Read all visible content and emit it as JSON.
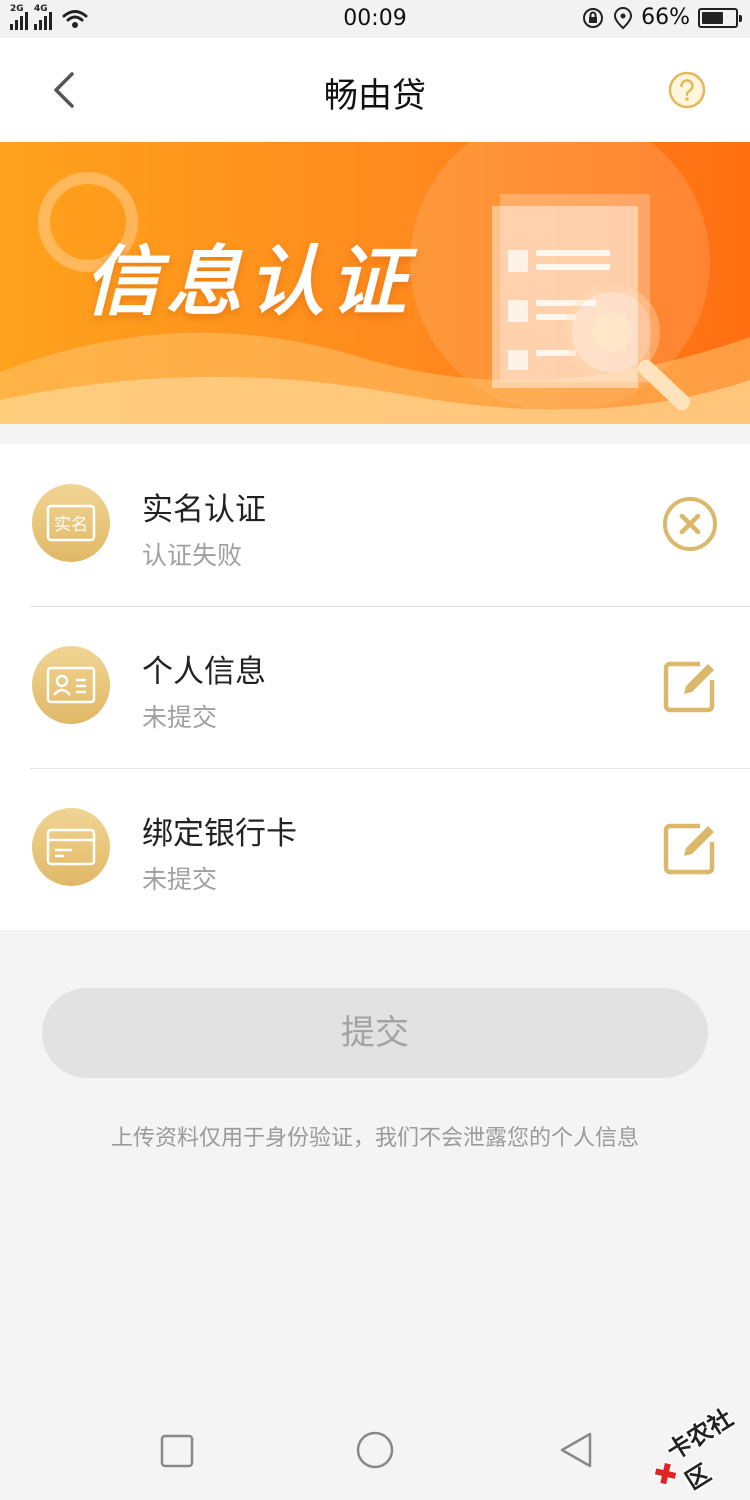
{
  "status_bar": {
    "network_1": "2G",
    "network_2": "4G",
    "time": "00:09",
    "battery": "66%",
    "battery_level": 0.66
  },
  "header": {
    "title": "畅由贷"
  },
  "banner": {
    "title": "信息认证"
  },
  "items": [
    {
      "title": "实名认证",
      "status": "认证失败",
      "icon_text": "实名",
      "action_icon": "close-circle-icon"
    },
    {
      "title": "个人信息",
      "status": "未提交",
      "action_icon": "edit-icon"
    },
    {
      "title": "绑定银行卡",
      "status": "未提交",
      "action_icon": "edit-icon"
    }
  ],
  "submit": {
    "label": "提交"
  },
  "note": "上传资料仅用于身份验证，我们不会泄露您的个人信息",
  "watermark": "卡农社区",
  "colors": {
    "accent_gold": "#e0b866",
    "banner_orange": "#ff7a1a",
    "disabled_button": "#e2e2e2"
  }
}
